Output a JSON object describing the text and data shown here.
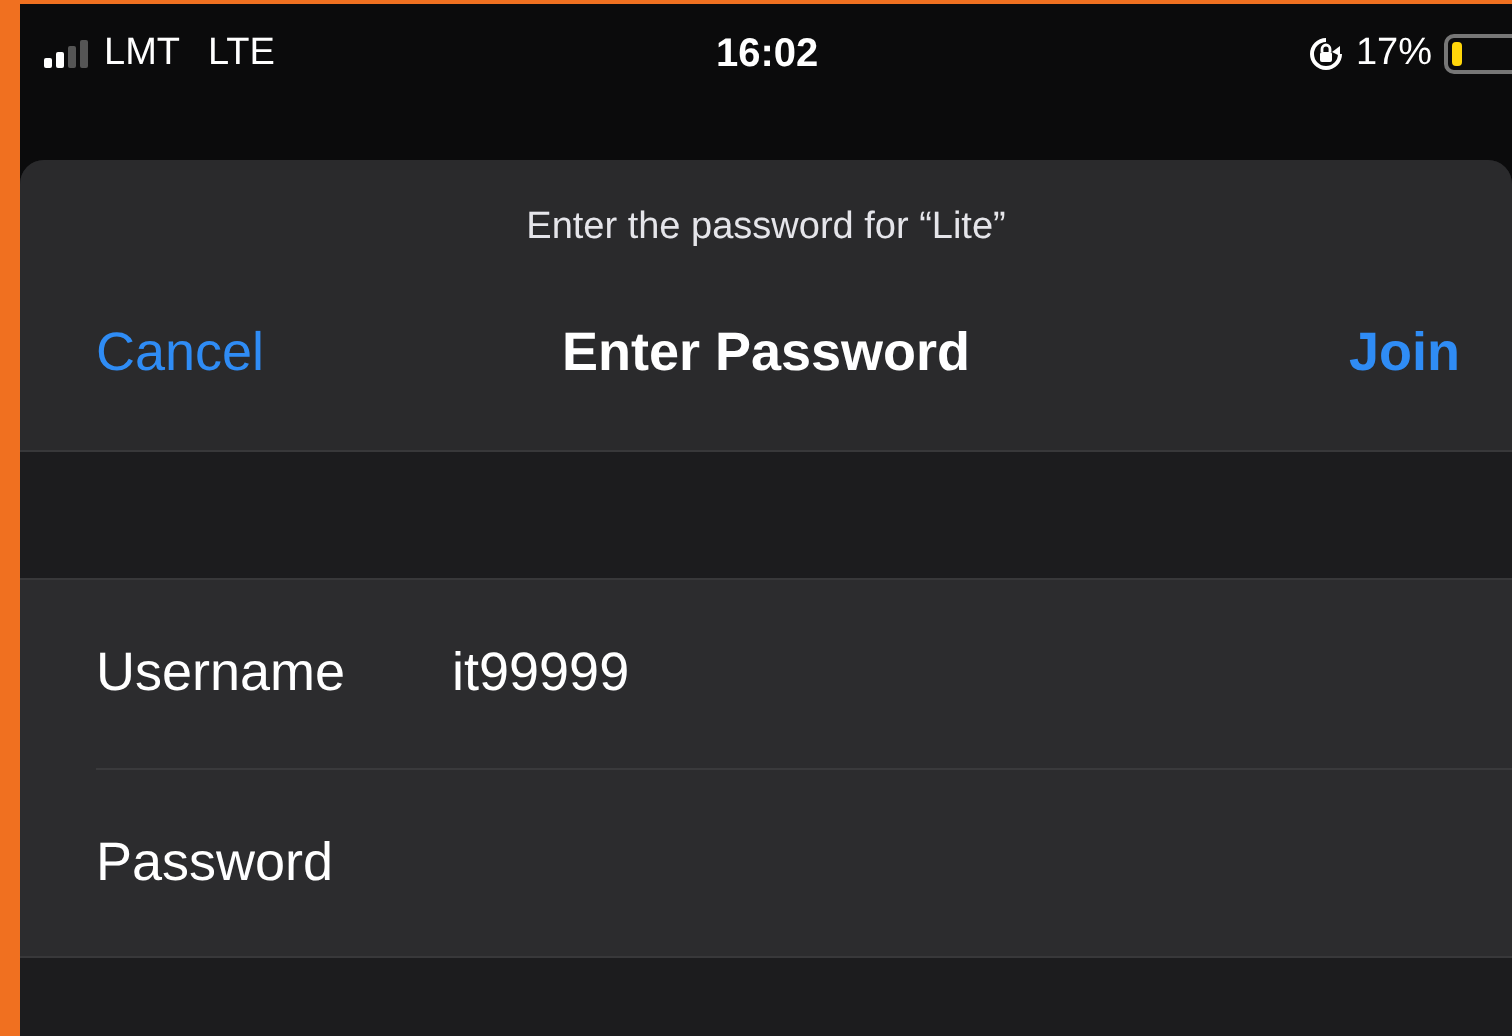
{
  "status_bar": {
    "signal_bars": {
      "level": 0.5
    },
    "carrier": "LMT",
    "network": "LTE",
    "time": "16:02",
    "battery_percent": "17%",
    "battery": {
      "level": 0.17
    }
  },
  "sheet": {
    "prompt": "Enter the password for “Lite”",
    "cancel": "Cancel",
    "title": "Enter Password",
    "join": "Join"
  },
  "fields": [
    {
      "label": "Username",
      "value": "it99999"
    },
    {
      "label": "Password"
    }
  ]
}
